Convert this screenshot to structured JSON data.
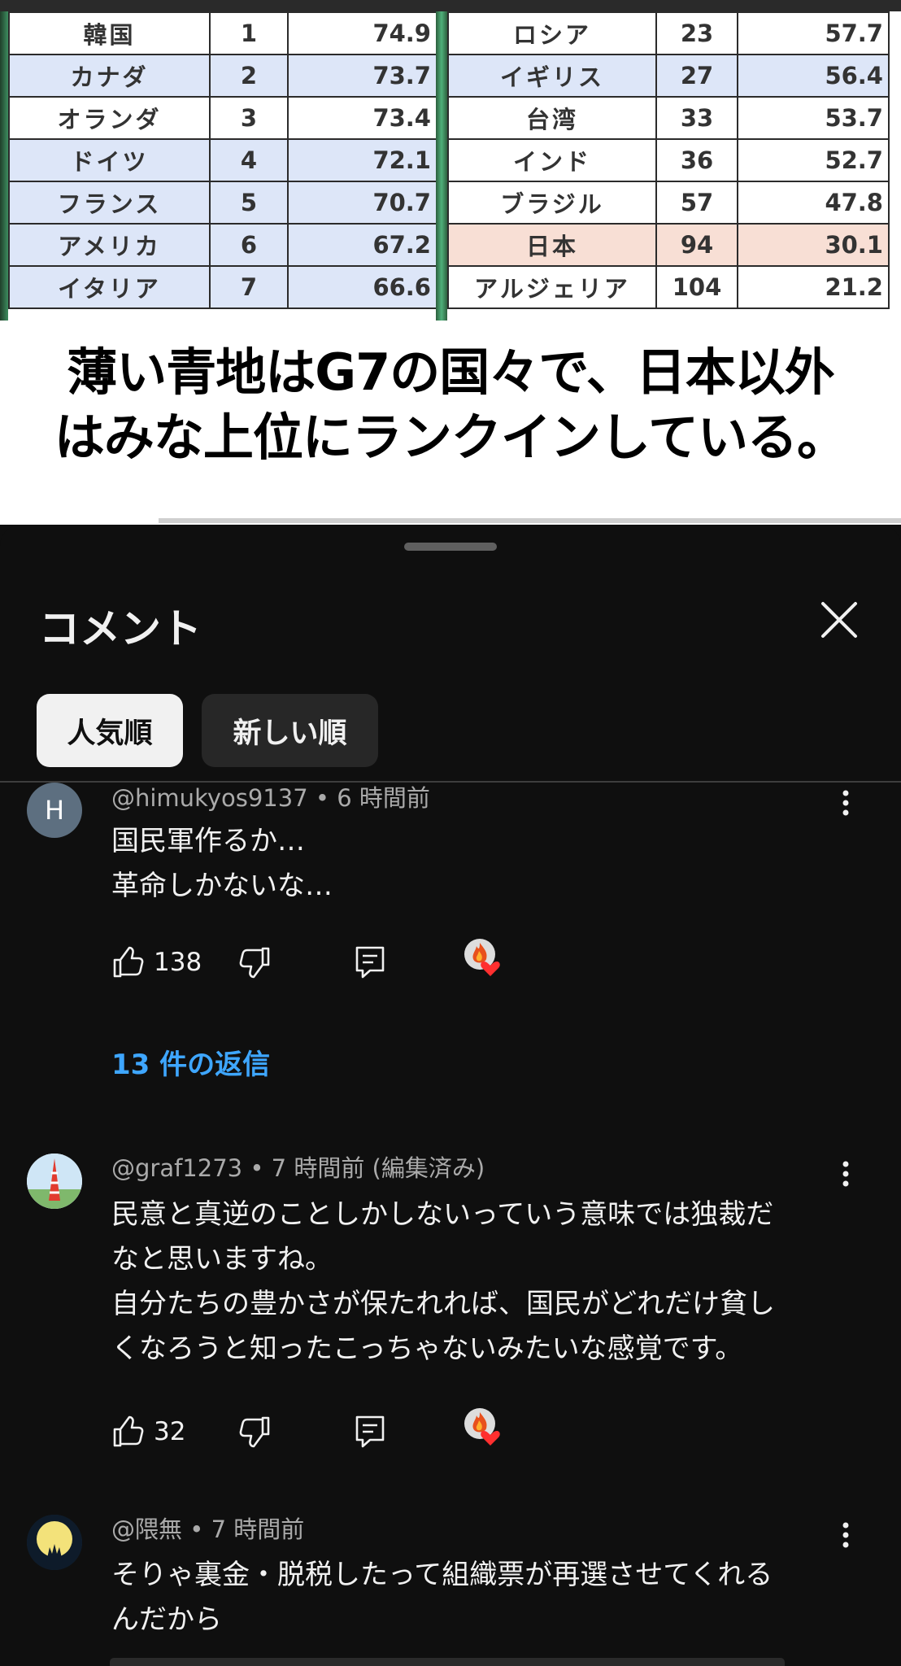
{
  "video": {
    "left_table": [
      {
        "country": "韓国",
        "rank": "1",
        "score": "74.9",
        "style": "white"
      },
      {
        "country": "カナダ",
        "rank": "2",
        "score": "73.7",
        "style": "blue"
      },
      {
        "country": "オランダ",
        "rank": "3",
        "score": "73.4",
        "style": "white"
      },
      {
        "country": "ドイツ",
        "rank": "4",
        "score": "72.1",
        "style": "blue"
      },
      {
        "country": "フランス",
        "rank": "5",
        "score": "70.7",
        "style": "blue"
      },
      {
        "country": "アメリカ",
        "rank": "6",
        "score": "67.2",
        "style": "blue"
      },
      {
        "country": "イタリア",
        "rank": "7",
        "score": "66.6",
        "style": "blue"
      }
    ],
    "right_table": [
      {
        "country": "ロシア",
        "rank": "23",
        "score": "57.7",
        "style": "white"
      },
      {
        "country": "イギリス",
        "rank": "27",
        "score": "56.4",
        "style": "blue"
      },
      {
        "country": "台湾",
        "rank": "33",
        "score": "53.7",
        "style": "white"
      },
      {
        "country": "インド",
        "rank": "36",
        "score": "52.7",
        "style": "white"
      },
      {
        "country": "ブラジル",
        "rank": "57",
        "score": "47.8",
        "style": "white"
      },
      {
        "country": "日本",
        "rank": "94",
        "score": "30.1",
        "style": "pink"
      },
      {
        "country": "アルジェリア",
        "rank": "104",
        "score": "21.2",
        "style": "white"
      }
    ],
    "caption_line1": "薄い青地はG7の国々で、日本以外",
    "caption_line2": "はみな上位にランクインしている。",
    "progress_fraction": 0.18
  },
  "sheet": {
    "title": "コメント",
    "sort_chips": [
      {
        "label": "人気順",
        "active": true
      },
      {
        "label": "新しい順",
        "active": false
      }
    ]
  },
  "comments": [
    {
      "avatar_letter": "H",
      "author": "@himukyos9137",
      "time": "6 時間前",
      "lines": [
        "国民軍作るか…",
        "革命しかないな…"
      ],
      "likes": "138",
      "replies": "13 件の返信"
    },
    {
      "author": "@graf1273",
      "time": "7 時間前 (編集済み)",
      "lines": [
        "民意と真逆のことしかしないっていう意味では独裁だ",
        "なと思いますね。",
        "自分たちの豊かさが保たれれば、国民がどれだけ貧し",
        "くなろうと知ったこっちゃないみたいな感覚です。"
      ],
      "likes": "32"
    },
    {
      "author": "@隈無",
      "time": "7 時間前",
      "lines": [
        "そりゃ裏金・脱税したって組織票が再選させてくれる",
        "んだから"
      ]
    }
  ],
  "colors": {
    "link": "#3ea6ff",
    "background": "#0f0f0f",
    "g7_blue": "#dde6f8",
    "japan_pink": "#f8dfd5"
  },
  "icons": [
    "close-icon",
    "like-icon",
    "dislike-icon",
    "reply-icon",
    "creator-heart-icon",
    "more-options-icon"
  ]
}
